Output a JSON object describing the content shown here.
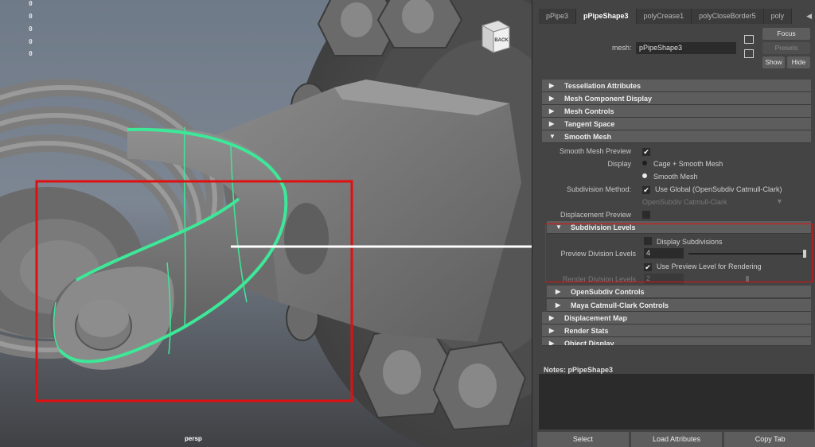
{
  "viewport": {
    "hud_values": [
      "0",
      "0",
      "0",
      "0",
      "0"
    ],
    "camera_label": "persp",
    "viewcube_label": "BACK"
  },
  "attribute_editor": {
    "tabs": [
      "pPipe3",
      "pPipeShape3",
      "polyCrease1",
      "polyCloseBorder5",
      "poly"
    ],
    "active_tab_index": 1,
    "mesh_label": "mesh:",
    "mesh_value": "pPipeShape3",
    "buttons": {
      "focus": "Focus",
      "presets": "Presets",
      "show": "Show",
      "hide": "Hide"
    },
    "sections": {
      "tessellation": "Tessellation Attributes",
      "mesh_component_display": "Mesh Component Display",
      "mesh_controls": "Mesh Controls",
      "tangent_space": "Tangent Space",
      "smooth_mesh": "Smooth Mesh",
      "subdivision_levels": "Subdivision Levels",
      "opensubdiv_controls": "OpenSubdiv Controls",
      "catmull_clark_controls": "Maya Catmull-Clark Controls",
      "displacement_map": "Displacement Map",
      "render_stats": "Render Stats",
      "object_display": "Object Display"
    },
    "smooth_mesh": {
      "preview_label": "Smooth Mesh Preview",
      "display_label": "Display",
      "display_option_1": "Cage + Smooth Mesh",
      "display_option_2": "Smooth Mesh",
      "subdivision_method_label": "Subdivision Method:",
      "subdivision_method_value": "Use Global (OpenSubdiv Catmull-Clark)",
      "subdivision_method_dropdown": "OpenSubdiv Catmull-Clark",
      "displacement_preview_label": "Displacement Preview"
    },
    "subdivision_levels": {
      "display_subdivisions_label": "Display Subdivisions",
      "preview_division_label": "Preview Division Levels",
      "preview_division_value": "4",
      "use_preview_label": "Use Preview Level for Rendering",
      "render_division_label": "Render Division Levels",
      "render_division_value": "2"
    },
    "notes_label": "Notes:  pPipeShape3",
    "bottom_buttons": {
      "select": "Select",
      "load_attributes": "Load Attributes",
      "copy_tab": "Copy Tab"
    }
  },
  "colors": {
    "highlight_red": "#e01010",
    "selection_green": "#3de898",
    "pointer_arrow": "#ffffff"
  }
}
